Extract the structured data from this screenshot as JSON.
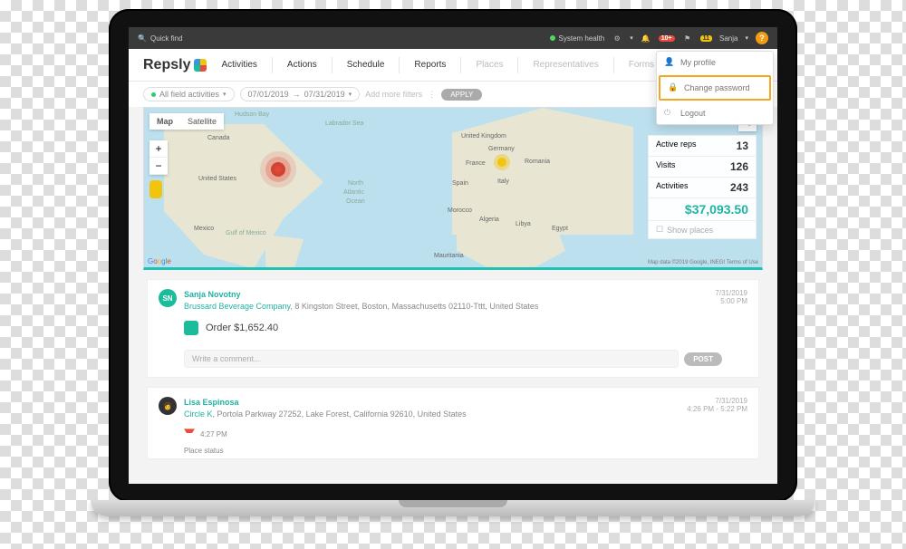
{
  "topbar": {
    "quick_find": "Quick find",
    "system_health": "System health",
    "notif_badge": "10+",
    "task_badge": "11",
    "username": "Sanja",
    "help": "?"
  },
  "logo": "Repsly",
  "nav": {
    "activities": "Activities",
    "actions": "Actions",
    "schedule": "Schedule",
    "reports": "Reports",
    "places": "Places",
    "representatives": "Representatives",
    "forms": "Forms"
  },
  "profile_menu": {
    "my_profile": "My profile",
    "change_password": "Change password",
    "logout": "Logout"
  },
  "filters": {
    "activity_type": "All field activities",
    "date_from": "07/01/2019",
    "date_to": "07/31/2019",
    "add_more": "Add more filters",
    "apply": "APPLY"
  },
  "map": {
    "tab_map": "Map",
    "tab_sat": "Satellite",
    "hudson": "Hudson Bay",
    "labrador": "Labrador Sea",
    "atlantic1": "North",
    "atlantic2": "Atlantic",
    "atlantic3": "Ocean",
    "uk": "United Kingdom",
    "france": "France",
    "germany": "Germany",
    "spain": "Spain",
    "italy": "Italy",
    "romania": "Romania",
    "morocco": "Morocco",
    "algeria": "Algeria",
    "libya": "Libya",
    "egypt": "Egypt",
    "mauritania": "Mauritania",
    "canada": "Canada",
    "us": "United States",
    "mexico": "Mexico",
    "gulf": "Gulf of Mexico",
    "google": "Google",
    "attrib": "Map data ©2019 Google, INEGI   Terms of Use"
  },
  "stats": {
    "active_reps_label": "Active reps",
    "active_reps": "13",
    "visits_label": "Visits",
    "visits": "126",
    "activities_label": "Activities",
    "activities": "243",
    "money": "$37,093.50",
    "show_places": "Show places"
  },
  "feed": [
    {
      "initials": "SN",
      "user": "Sanja Novotny",
      "place": "Brussard Beverage Company",
      "address": ", 8 Kingston Street, Boston, Massachusetts 02110-Tttt, United States",
      "date": "7/31/2019",
      "time": "5:00 PM",
      "order_label": "Order $1,652.40",
      "comment_ph": "Write a comment...",
      "post": "POST"
    },
    {
      "initials": "",
      "user": "Lisa Espinosa",
      "place": "Circle K",
      "address": ", Portola Parkway 27252, Lake Forest, California 92610, United States",
      "date": "7/31/2019",
      "time": "4:26 PM - 5:22 PM",
      "status_time": "4:27 PM",
      "status_label": "Place status"
    }
  ]
}
